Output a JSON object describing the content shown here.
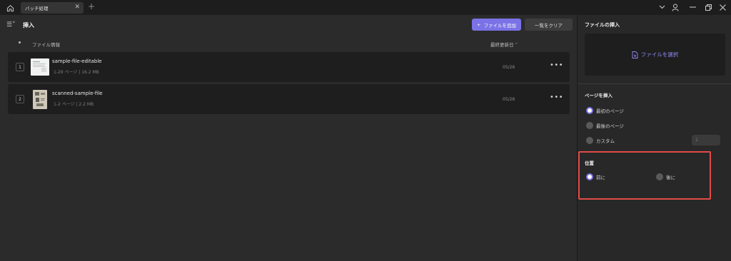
{
  "titlebar": {
    "tab_label": "バッチ処理",
    "tab_close": "✕",
    "new_tab": "+"
  },
  "toolbar": {
    "menu_glyph": "☰˅",
    "title": "挿入",
    "add_button": "ファイルを追加",
    "clear_button": "一覧をクリア"
  },
  "table": {
    "col_file": "ファイル情報",
    "col_date": "最終更新日 ˅",
    "rows": [
      {
        "num": "1",
        "name": "sample-file-editable",
        "meta": "1-29 ページ  |  16.2 MB",
        "date": "05/26",
        "more": "•••"
      },
      {
        "num": "2",
        "name": "scanned-sample-file",
        "meta": "1-2 ページ  |  2.2 MB",
        "date": "05/26",
        "more": "•••"
      }
    ]
  },
  "panel": {
    "title": "ファイルの挿入",
    "select_file": "ファイルを選択",
    "insert_page_title": "ページを挿入",
    "options": [
      "最初のページ",
      "最後のページ",
      "カスタム"
    ],
    "selected_option": "最初のページ",
    "custom_value": "1",
    "position_title": "位置",
    "position_options": [
      "前に",
      "後に"
    ],
    "selected_position": "前に"
  },
  "colors": {
    "accent": "#7a72e6",
    "highlight": "#e04b47",
    "background": "#2b2b2b"
  },
  "icons": [
    "home-icon",
    "close-icon",
    "plus-icon",
    "chevron-down-icon",
    "user-icon",
    "minimize-icon",
    "restore-icon",
    "file-add-icon",
    "more-icon"
  ]
}
